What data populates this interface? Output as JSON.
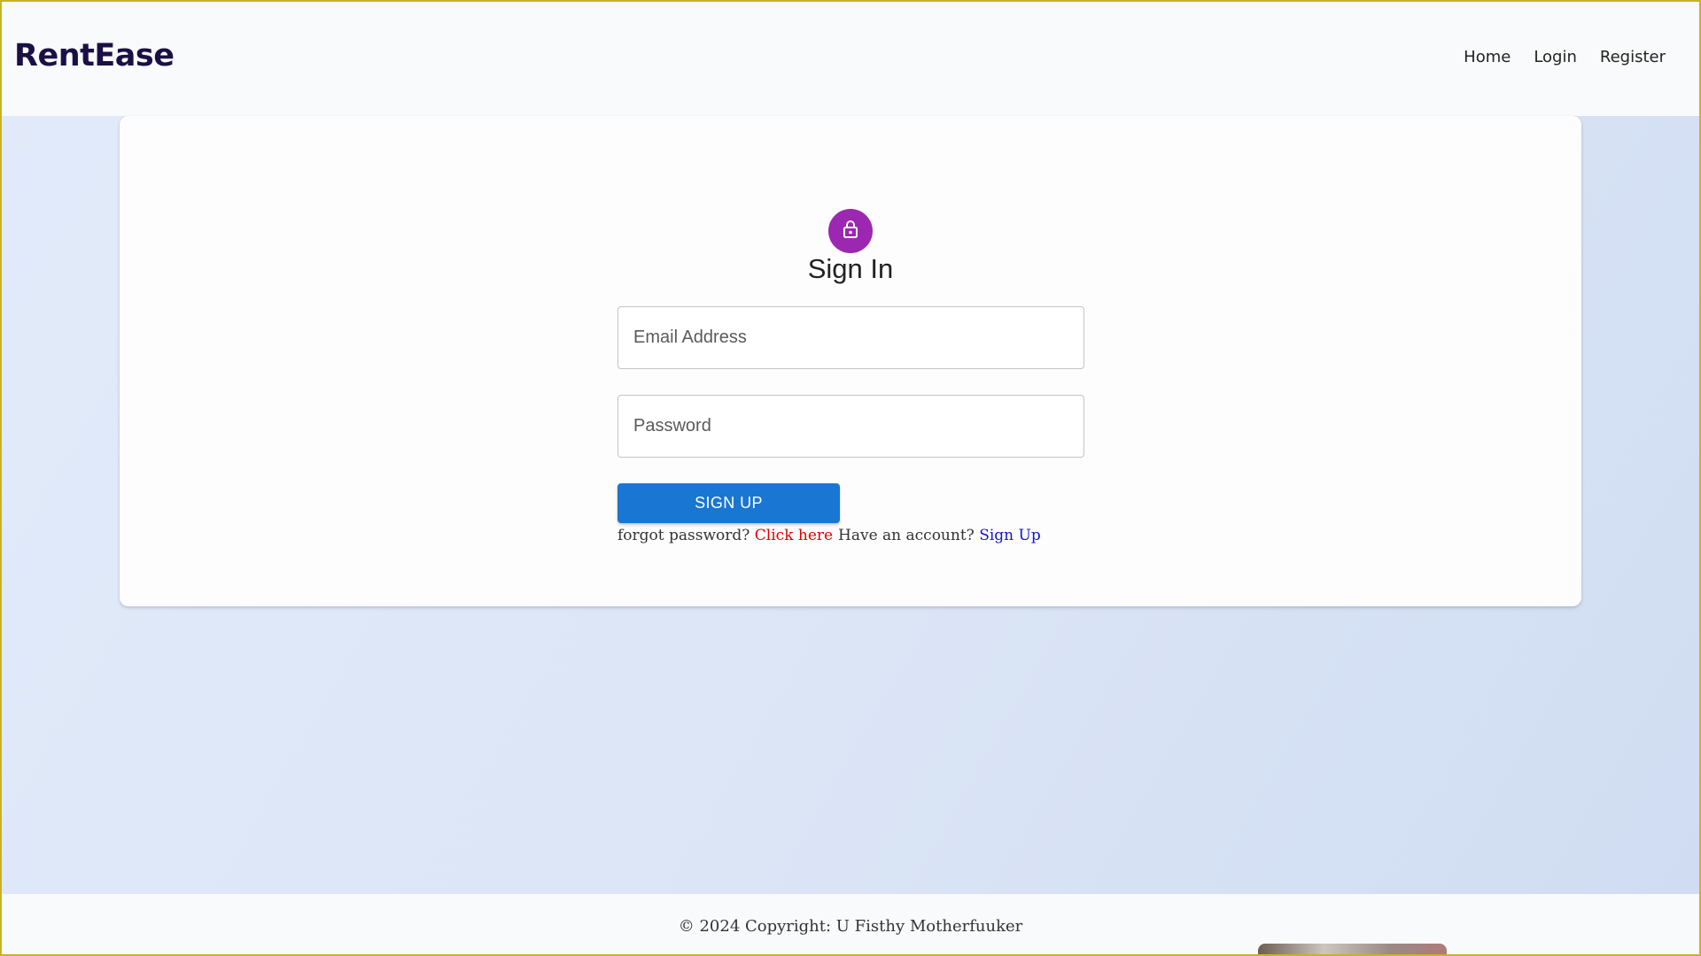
{
  "brand": "RentEase",
  "nav": {
    "links": [
      {
        "label": "Home"
      },
      {
        "label": "Login"
      },
      {
        "label": "Register"
      }
    ]
  },
  "form": {
    "icon": "lock-icon",
    "title": "Sign In",
    "email_placeholder": "Email Address",
    "password_placeholder": "Password",
    "button_label": "SIGN UP",
    "forgot_text": "forgot password?",
    "forgot_link": "Click here",
    "account_text": "Have an account?",
    "account_link": "Sign Up"
  },
  "footer": {
    "copyright": "© 2024 Copyright: U Fisthy Motherfuuker"
  },
  "colors": {
    "accent": "#1976d2",
    "avatar": "#9c27b0",
    "link_red": "#e00000",
    "link_blue": "#1511d8",
    "brand": "#1b1045"
  }
}
